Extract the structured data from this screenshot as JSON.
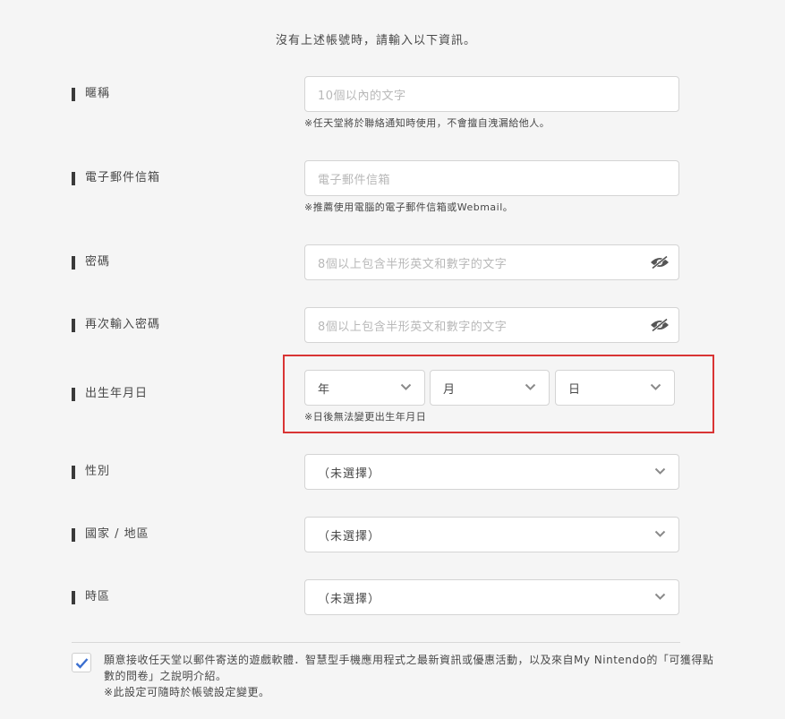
{
  "intro_text": "沒有上述帳號時，請輸入以下資訊。",
  "nickname": {
    "label": "暱稱",
    "placeholder": "10個以內的文字",
    "note": "※任天堂將於聯絡通知時使用，不會擅自洩漏給他人。"
  },
  "email": {
    "label": "電子郵件信箱",
    "placeholder": "電子郵件信箱",
    "note": "※推薦使用電腦的電子郵件信箱或Webmail。"
  },
  "password": {
    "label": "密碼",
    "placeholder": "8個以上包含半形英文和數字的文字",
    "icon": "eye-icon"
  },
  "password_confirm": {
    "label": "再次輸入密碼",
    "placeholder": "8個以上包含半形英文和數字的文字",
    "icon": "eye-icon"
  },
  "birthday": {
    "label": "出生年月日",
    "year": "年",
    "month": "月",
    "day": "日",
    "note": "※日後無法變更出生年月日",
    "highlight_color": "#d93434"
  },
  "gender": {
    "label": "性別",
    "value": "（未選擇）"
  },
  "country": {
    "label": "國家 / 地區",
    "value": "（未選擇）"
  },
  "timezone": {
    "label": "時區",
    "value": "（未選擇）"
  },
  "consent": {
    "checked": true,
    "line1": "願意接收任天堂以郵件寄送的遊戲軟體．智慧型手機應用程式之最新資訊或優惠活動，以及來自My Nintendo的「可獲得點",
    "line2": "數的問卷」之說明介紹。",
    "line3": "※此設定可隨時於帳號設定變更。",
    "check_color": "#3b6fd0"
  },
  "colors": {
    "background": "#f5f5f5",
    "field_border": "#d4d4d4",
    "text": "#484848",
    "placeholder": "#b8b8b8"
  }
}
